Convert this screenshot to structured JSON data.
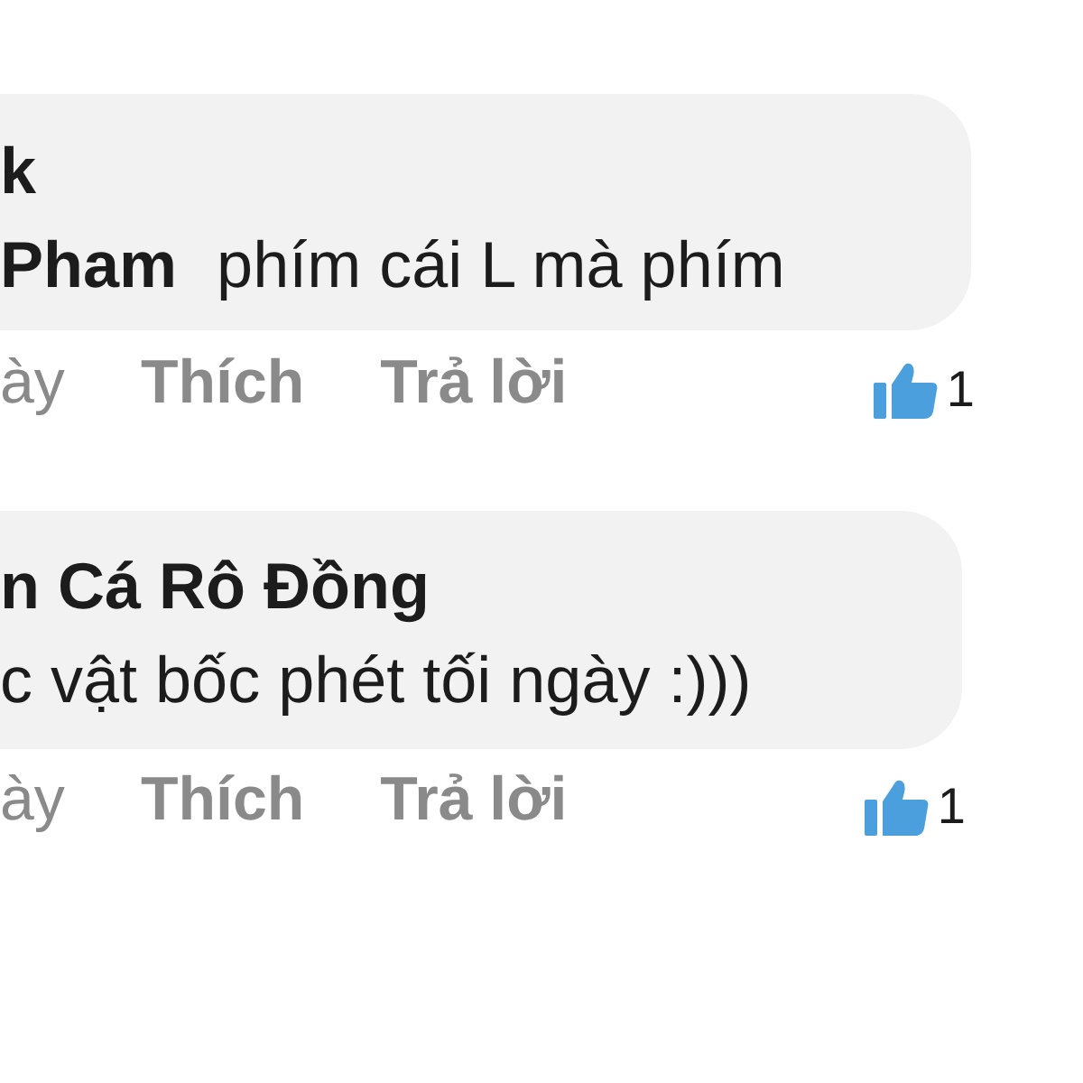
{
  "comments": [
    {
      "lines": [
        {
          "author": "k"
        },
        {
          "author": "Pham",
          "text": "phím cái L mà phím"
        }
      ],
      "time": "ày",
      "like": "Thích",
      "reply": "Trả lời",
      "reactions": "1"
    },
    {
      "lines": [
        {
          "author": "n Cá Rô Đồng"
        },
        {
          "text": "c vật bốc phét tối ngày :)))"
        }
      ],
      "time": "ày",
      "like": "Thích",
      "reply": "Trả lời",
      "reactions": "1"
    }
  ]
}
